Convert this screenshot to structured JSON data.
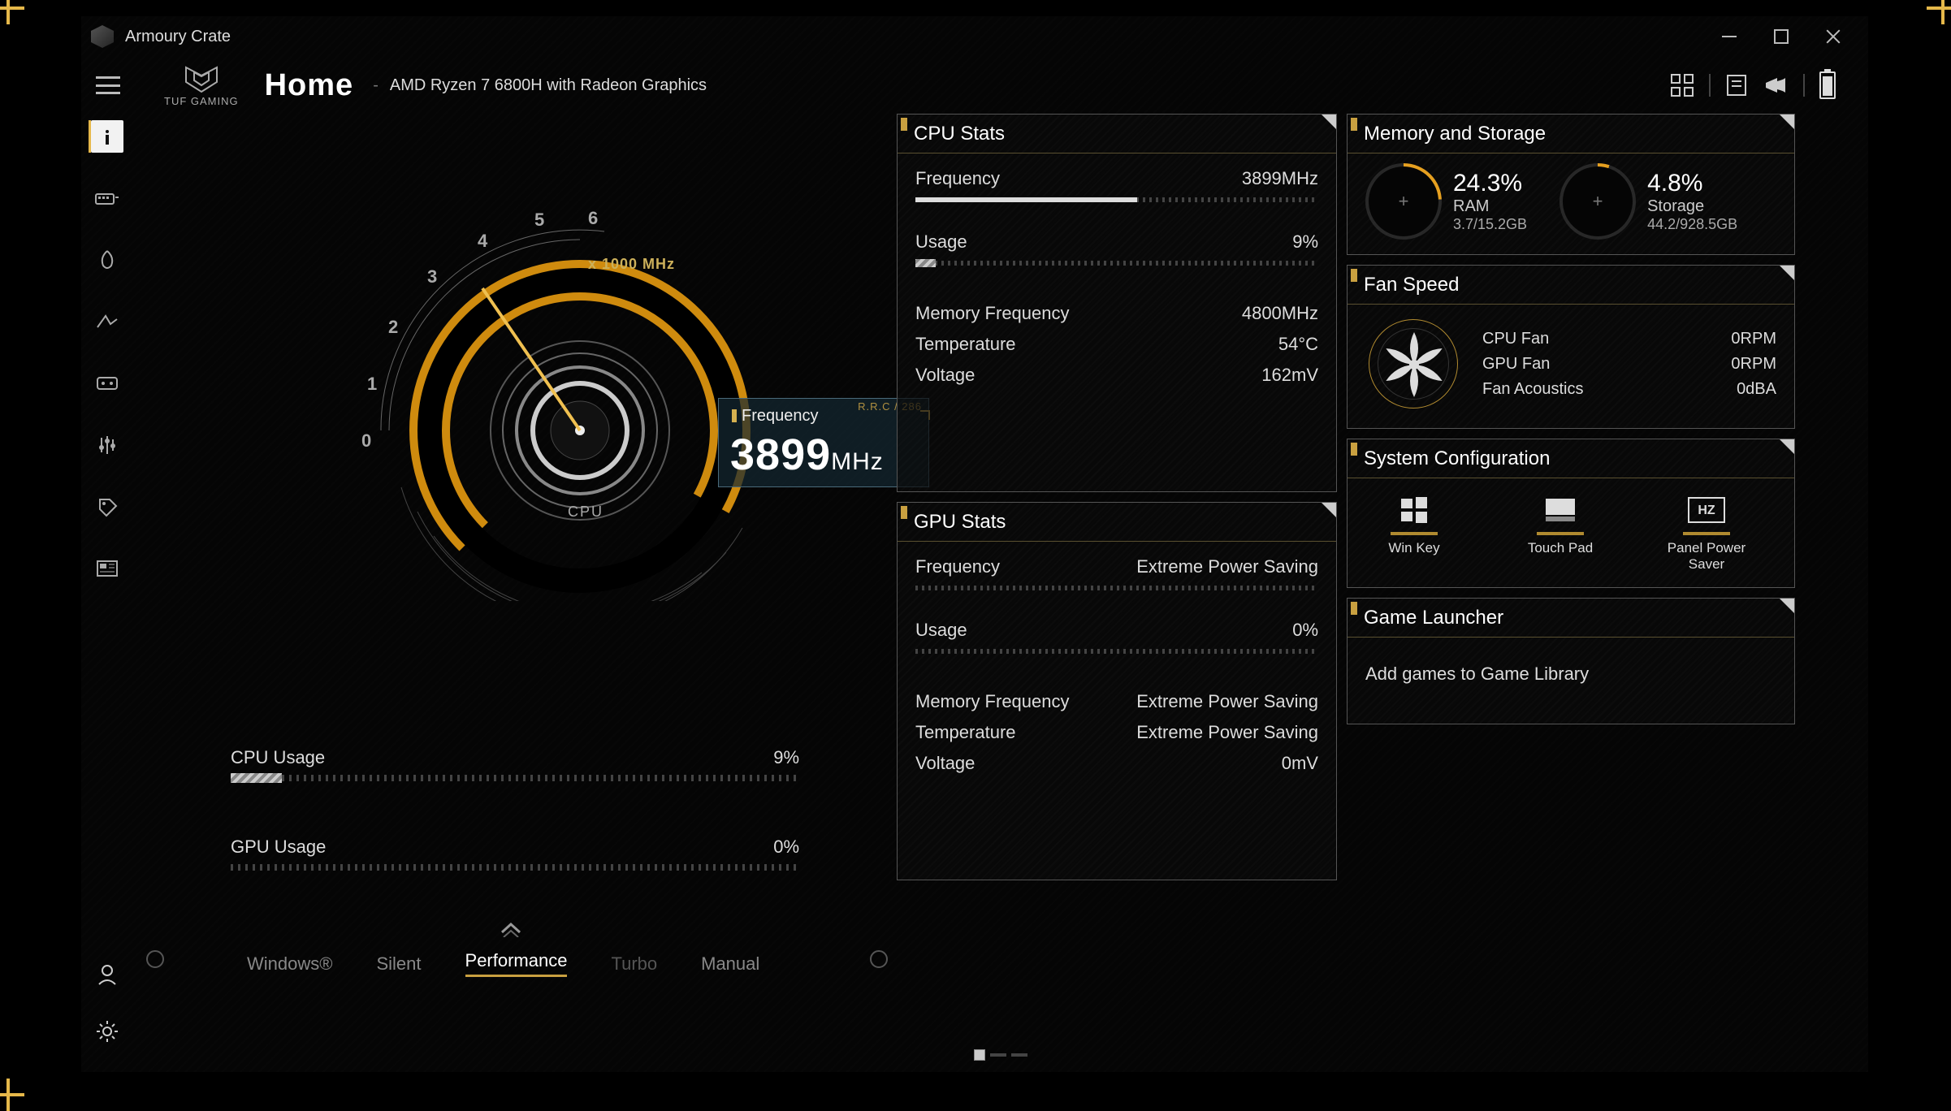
{
  "app_name": "Armoury Crate",
  "logo_text": "TUF GAMING",
  "page_title": "Home",
  "cpu_model": "AMD Ryzen 7 6800H with Radeon Graphics",
  "gauge": {
    "scale_label": "x 1000 MHz",
    "device": "CPU",
    "ticks": [
      "0",
      "1",
      "2",
      "3",
      "4",
      "5",
      "6"
    ],
    "box_tiny": "R.R.C / 286",
    "box_label": "Frequency",
    "box_value": "3899",
    "box_unit": "MHz"
  },
  "usage_bars": {
    "cpu": {
      "label": "CPU Usage",
      "value": "9%",
      "pct": 9
    },
    "gpu": {
      "label": "GPU Usage",
      "value": "0%",
      "pct": 0
    }
  },
  "modes": [
    "Windows®",
    "Silent",
    "Performance",
    "Turbo",
    "Manual"
  ],
  "mode_active": 2,
  "cpu_stats": {
    "title": "CPU Stats",
    "freq_l": "Frequency",
    "freq_v": "3899MHz",
    "freq_pct": 55,
    "usage_l": "Usage",
    "usage_v": "9%",
    "usage_pct": 9,
    "memf_l": "Memory Frequency",
    "memf_v": "4800MHz",
    "temp_l": "Temperature",
    "temp_v": "54°C",
    "volt_l": "Voltage",
    "volt_v": "162mV"
  },
  "gpu_stats": {
    "title": "GPU Stats",
    "freq_l": "Frequency",
    "freq_v": "Extreme Power Saving",
    "freq_pct": 0,
    "usage_l": "Usage",
    "usage_v": "0%",
    "usage_pct": 0,
    "memf_l": "Memory Frequency",
    "memf_v": "Extreme Power Saving",
    "temp_l": "Temperature",
    "temp_v": "Extreme Power Saving",
    "volt_l": "Voltage",
    "volt_v": "0mV"
  },
  "mem": {
    "title": "Memory and Storage",
    "ram_pct": "24.3%",
    "ram_lbl": "RAM",
    "ram_sub": "3.7/15.2GB",
    "sto_pct": "4.8%",
    "sto_lbl": "Storage",
    "sto_sub": "44.2/928.5GB"
  },
  "fan": {
    "title": "Fan Speed",
    "rows": [
      {
        "l": "CPU Fan",
        "v": "0RPM"
      },
      {
        "l": "GPU Fan",
        "v": "0RPM"
      },
      {
        "l": "Fan Acoustics",
        "v": "0dBA"
      }
    ]
  },
  "syscfg": {
    "title": "System Configuration",
    "opts": [
      {
        "l": "Win Key"
      },
      {
        "l": "Touch Pad"
      },
      {
        "l": "Panel Power Saver",
        "sub": "HZ"
      }
    ]
  },
  "launcher": {
    "title": "Game Launcher",
    "text": "Add games to Game Library"
  }
}
